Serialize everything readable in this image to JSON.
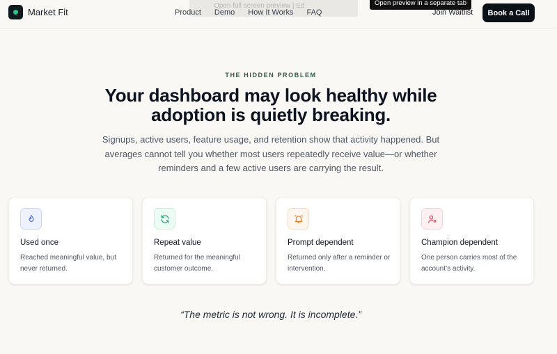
{
  "header": {
    "brand": "Market Fit",
    "nav": [
      "Product",
      "Demo",
      "How It Works",
      "FAQ"
    ],
    "ghost_text": "Open full screen preview | Ed",
    "tooltip": "Open preview in a separate tab",
    "join_label": "Join Waitlist",
    "book_label": "Book a Call"
  },
  "hero": {
    "eyebrow": "THE HIDDEN PROBLEM",
    "headline_line1": "Your dashboard may look healthy while",
    "headline_line2": "adoption is quietly breaking.",
    "subtext": "Signups, active users, feature usage, and retention show that activity happened. But averages cannot tell you whether most users repeatedly receive value—or whether reminders and a few active users are carrying the result."
  },
  "cards": [
    {
      "icon": "flame-icon",
      "color": "#4f6bd8",
      "title": "Used once",
      "desc": "Reached meaningful value, but never returned."
    },
    {
      "icon": "refresh-icon",
      "color": "#1f9d6b",
      "title": "Repeat value",
      "desc": "Returned for the meaningful customer outcome."
    },
    {
      "icon": "bell-icon",
      "color": "#ea7a2c",
      "title": "Prompt dependent",
      "desc": "Returned only after a reminder or intervention."
    },
    {
      "icon": "user-settings-icon",
      "color": "#e1475f",
      "title": "Champion dependent",
      "desc": "One person carries most of the account’s activity."
    }
  ],
  "quote": "“The metric is not wrong. It is incomplete.”"
}
